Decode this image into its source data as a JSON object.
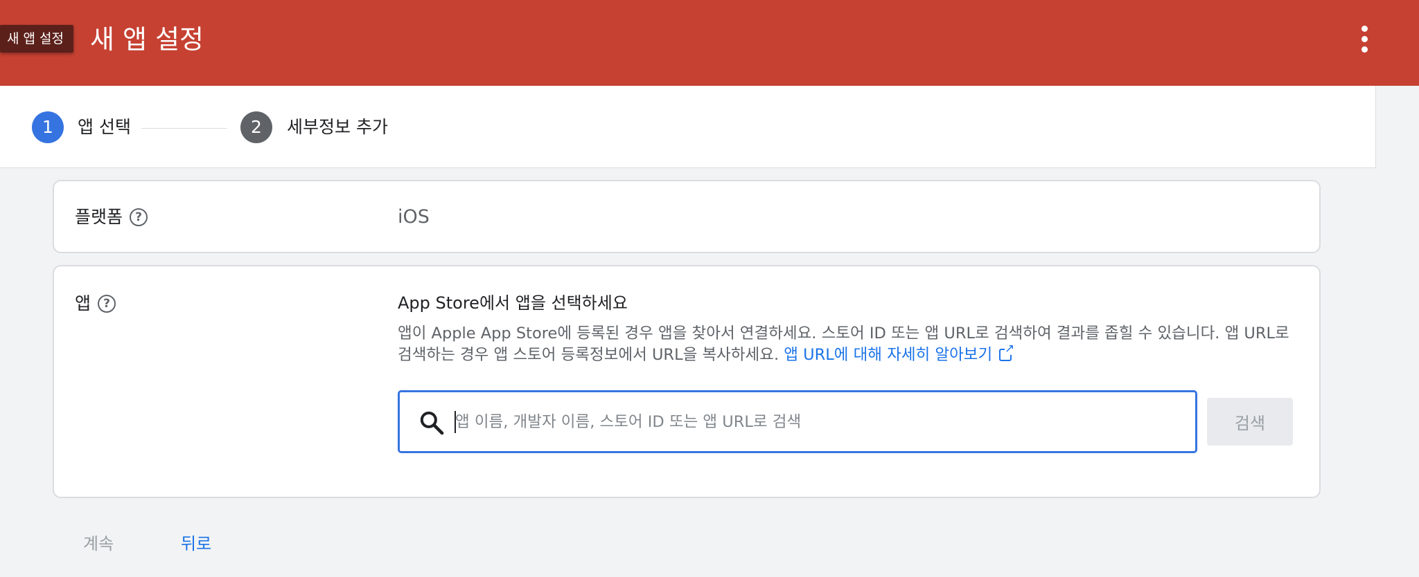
{
  "header": {
    "tooltip": "새 앱 설정",
    "title": "새 앱 설정",
    "menu_icon": "more-vert-icon"
  },
  "stepper": {
    "steps": [
      {
        "number": "1",
        "label": "앱 선택",
        "state": "active",
        "color": "#3574e0"
      },
      {
        "number": "2",
        "label": "세부정보 추가",
        "state": "inactive",
        "color": "#5f6368"
      }
    ]
  },
  "platform": {
    "label": "플랫폼",
    "value": "iOS"
  },
  "app": {
    "label": "앱",
    "heading": "App Store에서 앱을 선택하세요",
    "description": "앱이 Apple App Store에 등록된 경우 앱을 찾아서 연결하세요. 스토어 ID 또는 앱 URL로 검색하여 결과를 좁힐 수 있습니다. 앱 URL로 검색하는 경우 앱 스토어 등록정보에서 URL을 복사하세요.",
    "learn_more_link": "앱 URL에 대해 자세히 알아보기",
    "search_placeholder": "앱 이름, 개발자 이름, 스토어 ID 또는 앱 URL로 검색",
    "search_value": "",
    "search_button": "검색"
  },
  "footer": {
    "continue_label": "계속",
    "back_label": "뒤로"
  },
  "colors": {
    "header_bg": "#c64132",
    "accent": "#3574e0",
    "link": "#1a73e8"
  }
}
